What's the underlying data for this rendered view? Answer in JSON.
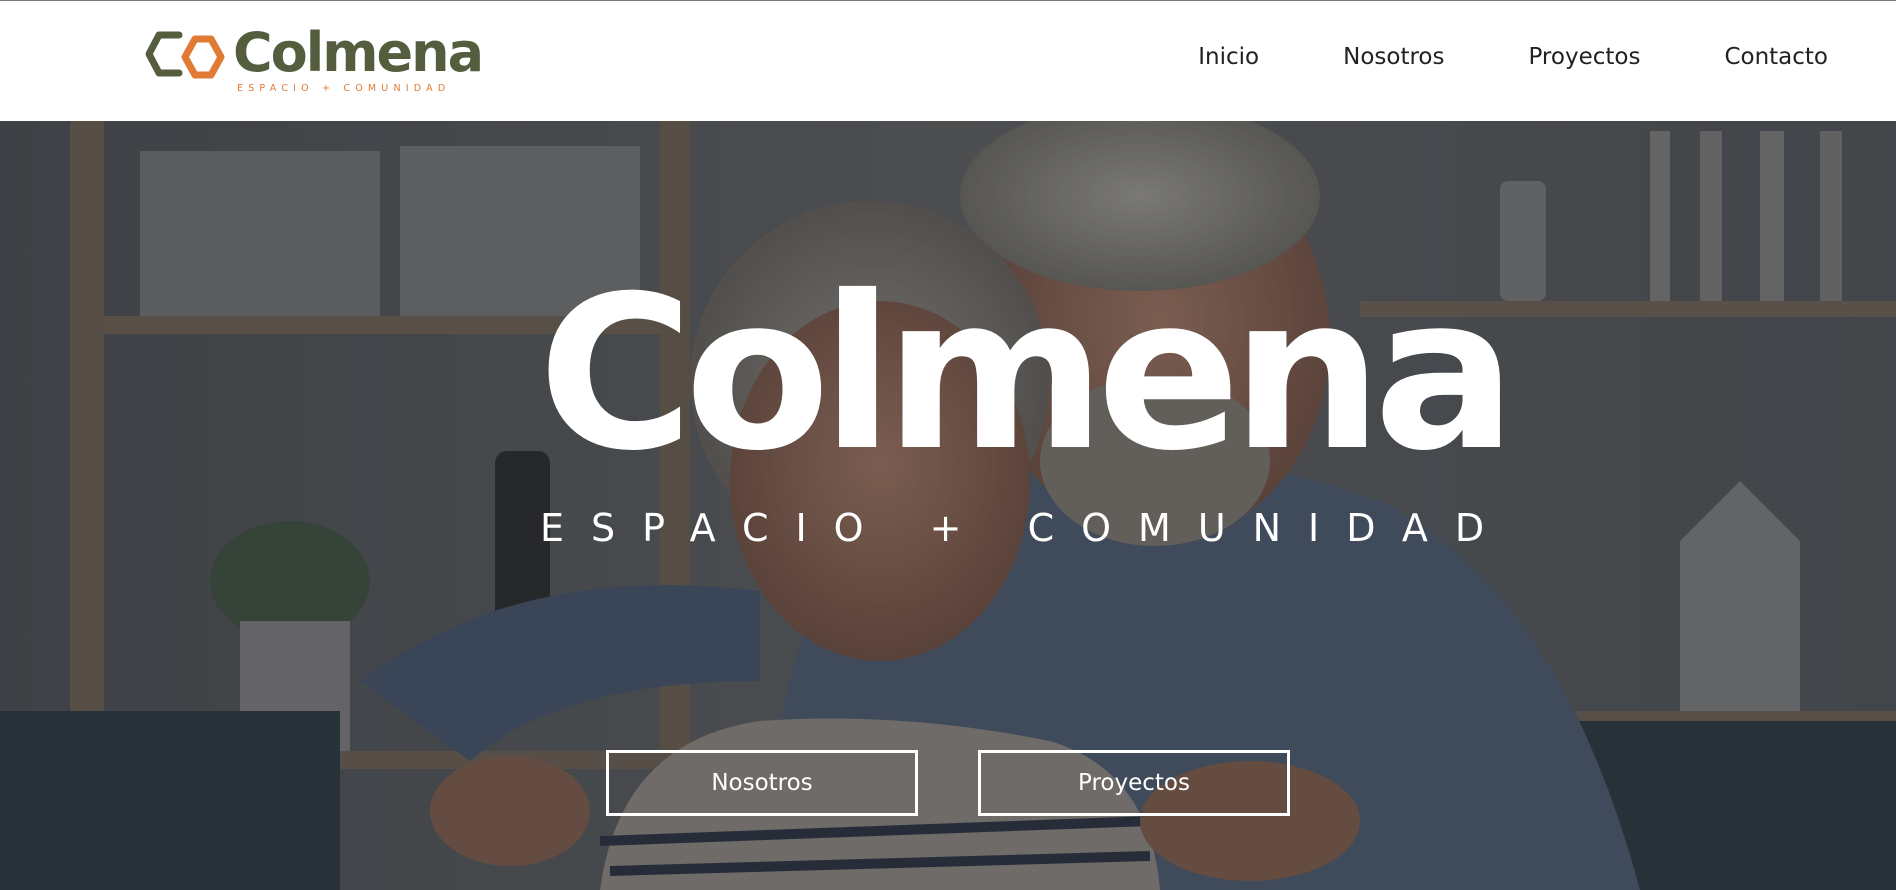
{
  "brand": {
    "name": "Colmena",
    "tagline": "ESPACIO + COMUNIDAD",
    "colors": {
      "olive": "#545d3e",
      "orange": "#e07a34"
    }
  },
  "nav": {
    "items": [
      {
        "label": "Inicio"
      },
      {
        "label": "Nosotros"
      },
      {
        "label": "Proyectos"
      },
      {
        "label": "Contacto"
      }
    ]
  },
  "hero": {
    "title": "Colmena",
    "tagline": "ESPACIO + COMUNIDAD",
    "image": "smiling-elderly-couple-photo",
    "buttons": [
      {
        "label": "Nosotros"
      },
      {
        "label": "Proyectos"
      }
    ]
  }
}
